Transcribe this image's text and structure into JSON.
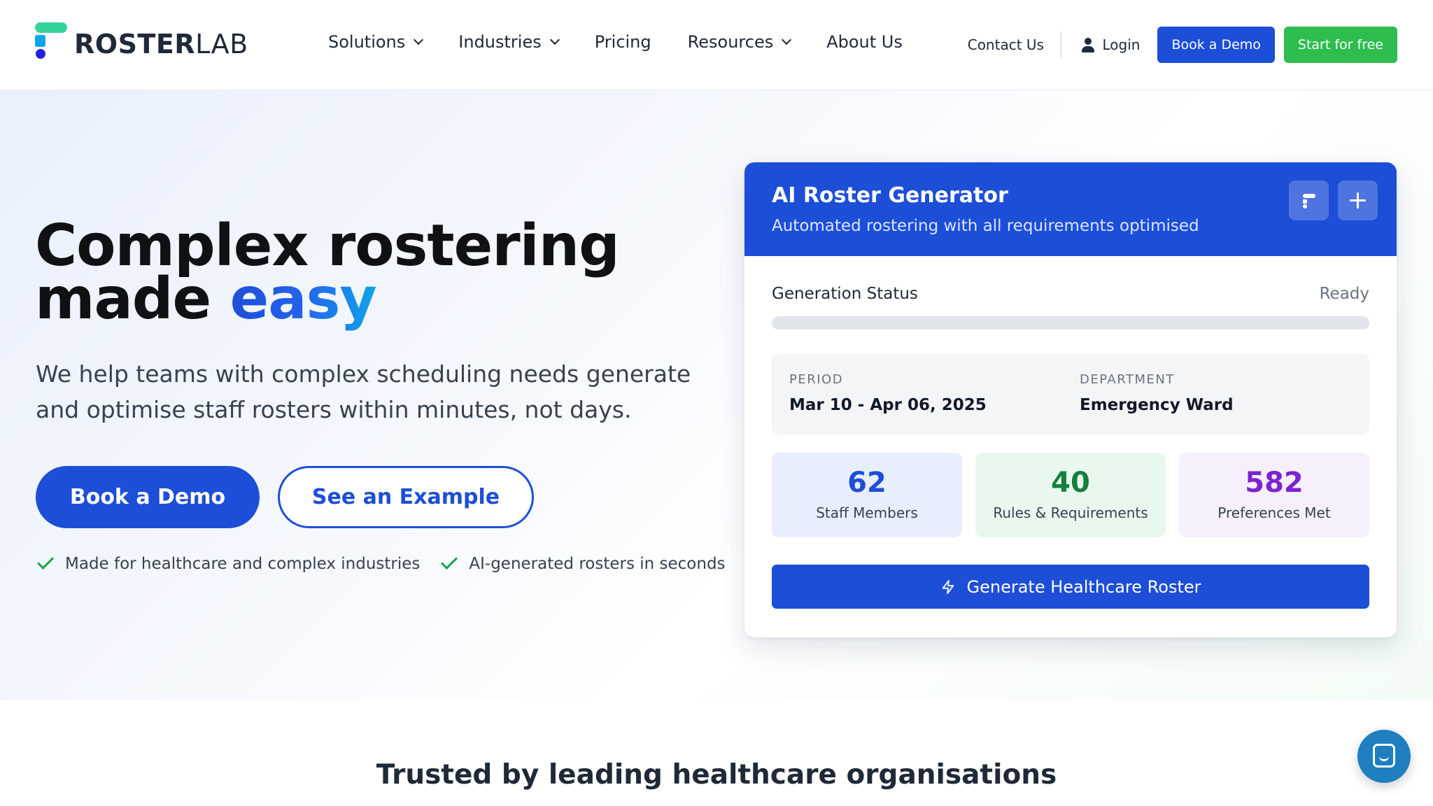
{
  "brand": {
    "name_bold": "ROSTER",
    "name_light": "LAB",
    "colors": {
      "accent": "#1d4ed8",
      "green": "#2ebd4e"
    }
  },
  "nav": {
    "menu": [
      {
        "label": "Solutions",
        "dropdown": true
      },
      {
        "label": "Industries",
        "dropdown": true
      },
      {
        "label": "Pricing",
        "dropdown": false
      },
      {
        "label": "Resources",
        "dropdown": true
      },
      {
        "label": "About Us",
        "dropdown": false
      }
    ],
    "contact": "Contact Us",
    "login": "Login",
    "book_demo": "Book a Demo",
    "start_free": "Start for free"
  },
  "hero": {
    "headline_line1": "Complex rostering",
    "headline_line2_prefix": "made ",
    "headline_highlight": "easy",
    "subtitle": "We help teams with complex scheduling needs generate and optimise staff rosters within minutes, not days.",
    "cta_primary": "Book a Demo",
    "cta_secondary": "See an Example",
    "checks": [
      "Made for healthcare and complex industries",
      "AI-generated rosters in seconds"
    ]
  },
  "card": {
    "title": "AI Roster Generator",
    "subtitle": "Automated rostering with all requirements optimised",
    "status_label": "Generation Status",
    "status_value": "Ready",
    "progress_fraction": 0,
    "period_label": "PERIOD",
    "period_value": "Mar 10 - Apr 06, 2025",
    "department_label": "DEPARTMENT",
    "department_value": "Emergency Ward",
    "stats": [
      {
        "value": "62",
        "label": "Staff Members"
      },
      {
        "value": "40",
        "label": "Rules & Requirements"
      },
      {
        "value": "582",
        "label": "Preferences Met"
      }
    ],
    "generate_button": "Generate Healthcare Roster"
  },
  "trusted": "Trusted by leading healthcare organisations",
  "icons": {
    "chat": "chat-icon",
    "user": "user-icon",
    "bolt": "bolt-icon",
    "check": "check-icon",
    "chevron": "chevron-down-icon",
    "plus": "plus-icon"
  }
}
